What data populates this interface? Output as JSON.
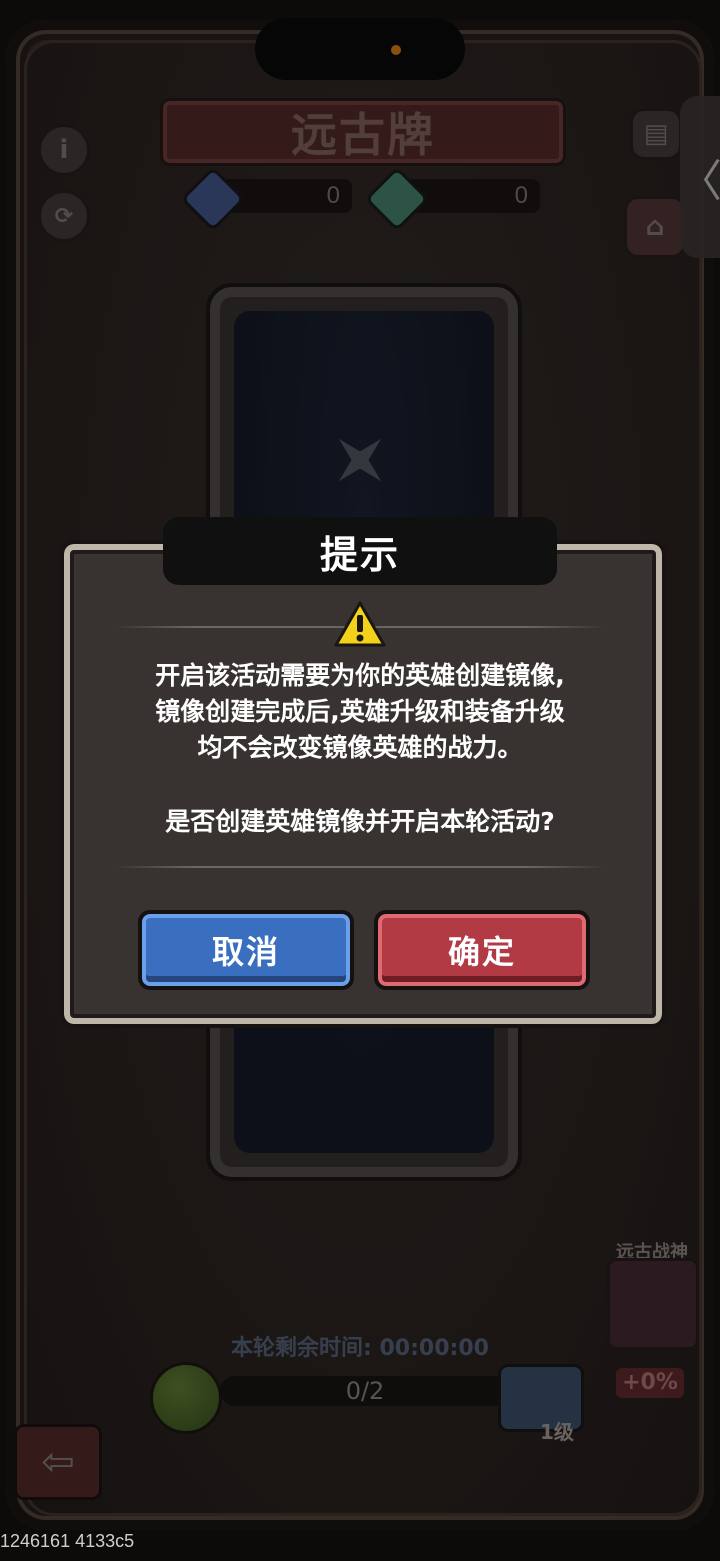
{
  "header": {
    "title": "远古牌",
    "currency_left": {
      "icon": "blue-gem-icon",
      "value": "0",
      "color": "#4b5f9a"
    },
    "currency_right": {
      "icon": "green-gem-icon",
      "value": "0",
      "color": "#4f8f7a"
    },
    "info_icon": "i",
    "right_tab_glyph": "〈"
  },
  "dialog": {
    "title": "提示",
    "message_lines": [
      "开启该活动需要为你的英雄创建镜像,",
      "镜像创建完成后,英雄升级和装备升级",
      "均不会改变镜像英雄的战力。"
    ],
    "question": "是否创建英雄镜像并开启本轮活动?",
    "cancel_label": "取消",
    "confirm_label": "确定"
  },
  "footer": {
    "timer_text": "本轮剩余时间: 00:00:00",
    "progress_text": "0/2",
    "progress_fraction": 0,
    "chest_level": "1级",
    "god_label": "远古战神",
    "god_bonus": "+0%",
    "back_glyph": "⇦"
  },
  "debug": "1246161 4133c5"
}
